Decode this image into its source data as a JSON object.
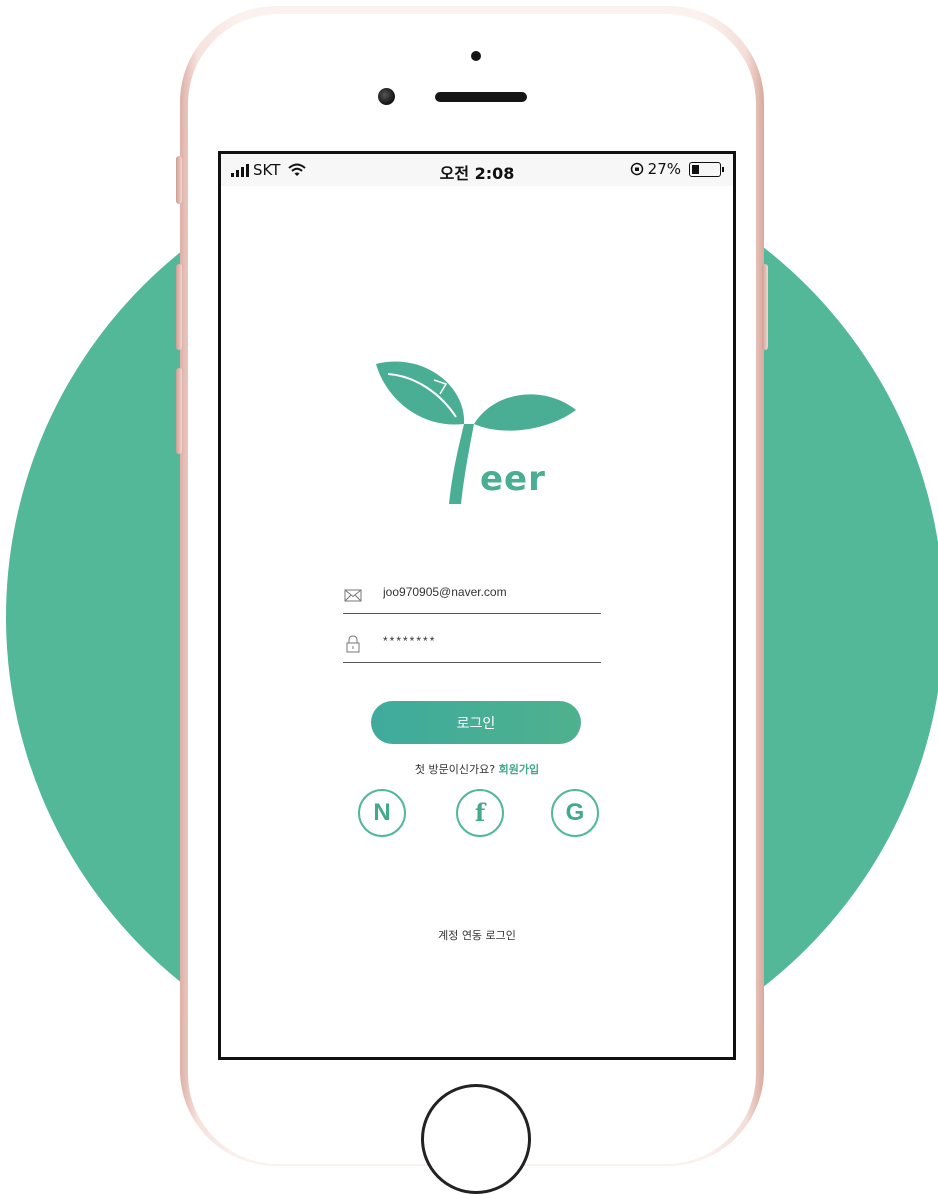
{
  "status_bar": {
    "carrier": "SKT",
    "time": "오전 2:08",
    "battery_percent_label": "27%",
    "battery_level": 0.27
  },
  "brand": {
    "logo_text": "eer",
    "accent_color": "#52b898",
    "dark_accent": "#42aa8c"
  },
  "login_form": {
    "email_value": "joo970905@naver.com",
    "password_value": "********",
    "email_icon": "envelope-icon",
    "password_icon": "lock-icon",
    "login_button_label": "로그인"
  },
  "signup": {
    "prompt": "첫 방문이신가요?",
    "link_label": "회원가입"
  },
  "social_login": {
    "providers": [
      {
        "name": "naver",
        "glyph": "N"
      },
      {
        "name": "facebook",
        "glyph": "f"
      },
      {
        "name": "google",
        "glyph": "G"
      }
    ],
    "caption": "계정 연동 로그인"
  }
}
